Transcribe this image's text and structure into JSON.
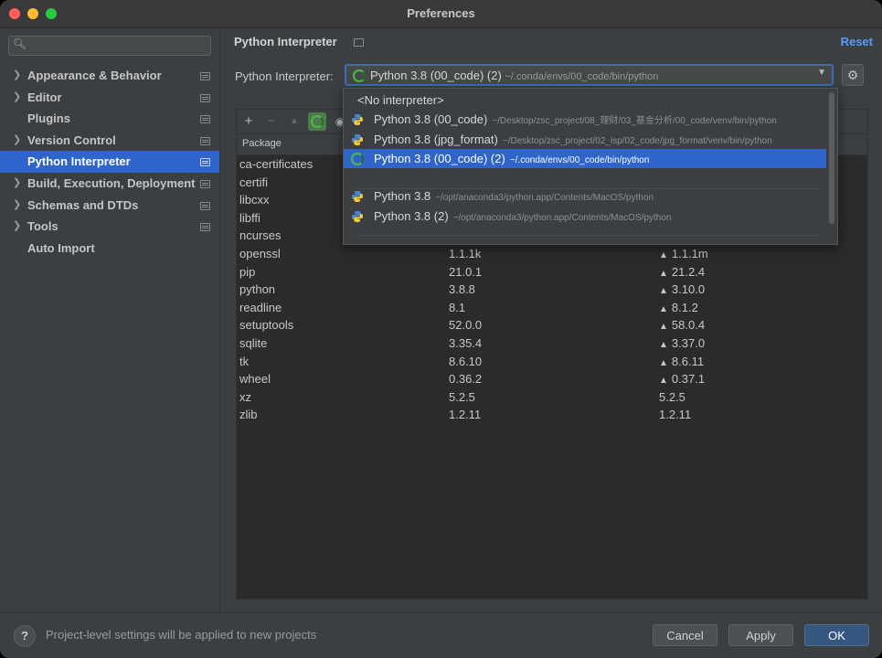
{
  "window": {
    "title": "Preferences"
  },
  "sidebar": {
    "search_placeholder": "",
    "items": [
      {
        "label": "Appearance & Behavior",
        "expandable": true
      },
      {
        "label": "Editor",
        "expandable": true
      },
      {
        "label": "Plugins",
        "expandable": false
      },
      {
        "label": "Version Control",
        "expandable": true
      },
      {
        "label": "Python Interpreter",
        "expandable": false,
        "selected": true
      },
      {
        "label": "Build, Execution, Deployment",
        "expandable": true
      },
      {
        "label": "Schemas and DTDs",
        "expandable": true
      },
      {
        "label": "Tools",
        "expandable": true
      },
      {
        "label": "Auto Import",
        "expandable": false
      }
    ]
  },
  "main": {
    "heading": "Python Interpreter",
    "reset_label": "Reset",
    "interpreter_label": "Python Interpreter:",
    "selected_interpreter": {
      "name": "Python 3.8 (00_code) (2)",
      "path": "~/.conda/envs/00_code/bin/python"
    },
    "table_header": "Package",
    "packages": [
      {
        "name": "ca-certificates",
        "version": "",
        "latest": "",
        "upgrade": false
      },
      {
        "name": "certifi",
        "version": "",
        "latest": "",
        "upgrade": false
      },
      {
        "name": "libcxx",
        "version": "",
        "latest": "",
        "upgrade": false
      },
      {
        "name": "libffi",
        "version": "",
        "latest": "",
        "upgrade": false
      },
      {
        "name": "ncurses",
        "version": "",
        "latest": "",
        "upgrade": false
      },
      {
        "name": "openssl",
        "version": "1.1.1k",
        "latest": "1.1.1m",
        "upgrade": true
      },
      {
        "name": "pip",
        "version": "21.0.1",
        "latest": "21.2.4",
        "upgrade": true
      },
      {
        "name": "python",
        "version": "3.8.8",
        "latest": "3.10.0",
        "upgrade": true
      },
      {
        "name": "readline",
        "version": "8.1",
        "latest": "8.1.2",
        "upgrade": true
      },
      {
        "name": "setuptools",
        "version": "52.0.0",
        "latest": "58.0.4",
        "upgrade": true
      },
      {
        "name": "sqlite",
        "version": "3.35.4",
        "latest": "3.37.0",
        "upgrade": true
      },
      {
        "name": "tk",
        "version": "8.6.10",
        "latest": "8.6.11",
        "upgrade": true
      },
      {
        "name": "wheel",
        "version": "0.36.2",
        "latest": "0.37.1",
        "upgrade": true
      },
      {
        "name": "xz",
        "version": "5.2.5",
        "latest": "5.2.5",
        "upgrade": false
      },
      {
        "name": "zlib",
        "version": "1.2.11",
        "latest": "1.2.11",
        "upgrade": false
      }
    ]
  },
  "dropdown": {
    "no_interpreter": "<No interpreter>",
    "options": [
      {
        "name": "Python 3.8 (00_code)",
        "path": "~/Desktop/zsc_project/08_理财/03_基金分析/00_code/venv/bin/python",
        "icon": "python-icon"
      },
      {
        "name": "Python 3.8 (jpg_format)",
        "path": "~/Desktop/zsc_project/02_isp/02_code/jpg_format/venv/bin/python",
        "icon": "python-icon"
      },
      {
        "name": "Python 3.8 (00_code) (2)",
        "path": "~/.conda/envs/00_code/bin/python",
        "icon": "conda-ring-icon",
        "selected": true
      },
      {
        "name": "Python 3.8",
        "path": "~/opt/anaconda3/python.app/Contents/MacOS/python",
        "icon": "python-icon"
      },
      {
        "name": "Python 3.8 (2)",
        "path": "~/opt/anaconda3/python.app/Contents/MacOS/python",
        "icon": "python-icon"
      }
    ]
  },
  "footer": {
    "help_label": "?",
    "info_text": "Project-level settings will be applied to new projects",
    "cancel_label": "Cancel",
    "apply_label": "Apply",
    "ok_label": "OK"
  },
  "colors": {
    "accent": "#2f65ca",
    "link": "#589df6",
    "conda_green": "#4eb94a"
  }
}
